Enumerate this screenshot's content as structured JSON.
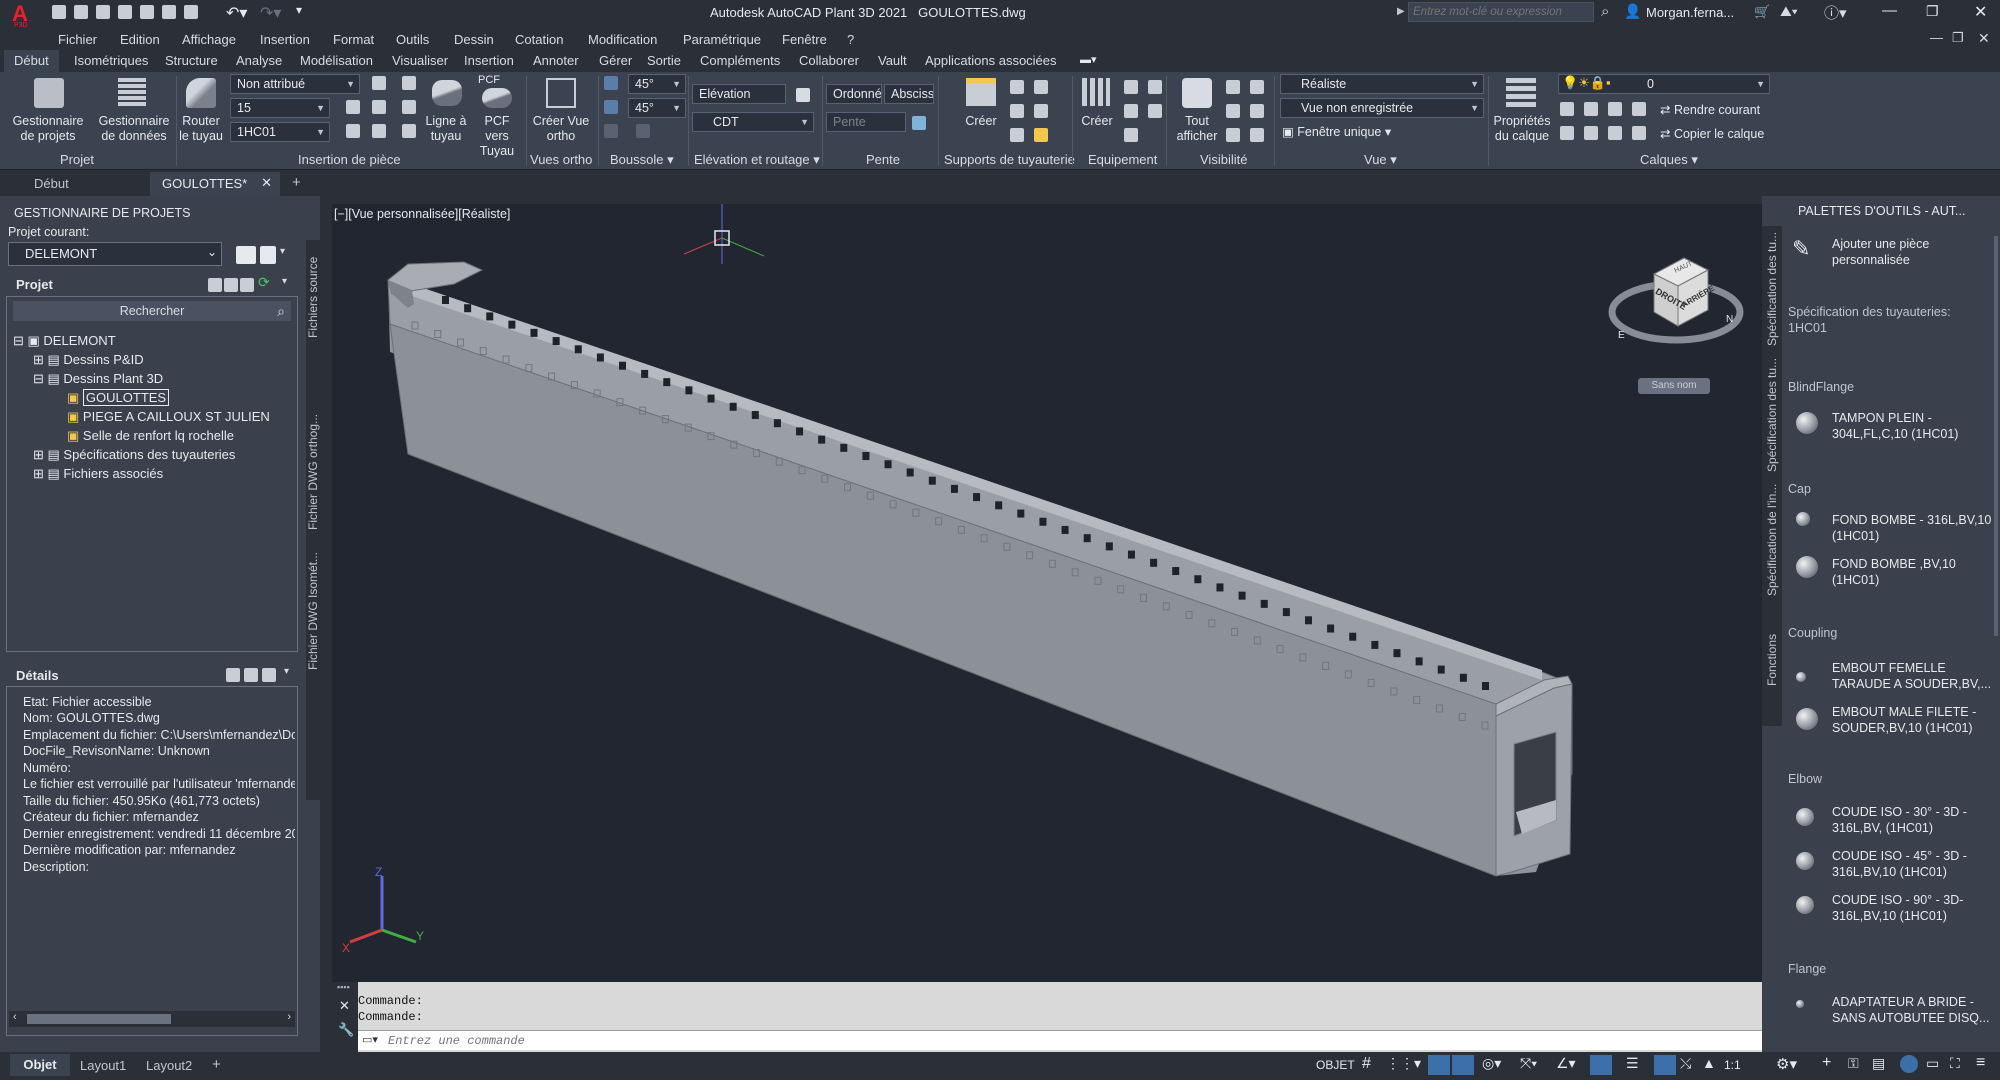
{
  "app": {
    "logo": "A",
    "logo_sub": "P3D",
    "title": "Autodesk AutoCAD Plant 3D 2021",
    "file": "GOULOTTES.dwg",
    "search_placeholder": "Entrez mot-clé ou expression",
    "user": "Morgan.ferna..."
  },
  "menu": [
    "Fichier",
    "Edition",
    "Affichage",
    "Insertion",
    "Format",
    "Outils",
    "Dessin",
    "Cotation",
    "Modification",
    "Paramétrique",
    "Fenêtre",
    "?"
  ],
  "ribbon_tabs": [
    "Début",
    "Isométriques",
    "Structure",
    "Analyse",
    "Modélisation",
    "Visualiser",
    "Insertion",
    "Annoter",
    "Gérer",
    "Sortie",
    "Compléments",
    "Collaborer",
    "Vault",
    "Applications associées"
  ],
  "ribbon": {
    "gestionnaire_projets": "Gestionnaire de projets",
    "gestionnaire_donnees": "Gestionnaire de données",
    "panel_projet": "Projet",
    "router": "Router le tuyau",
    "combo_attribut": "Non attribué",
    "combo_size": "15",
    "combo_spec": "1HC01",
    "ligne_tuyau": "Ligne à tuyau",
    "pcf": "PCF",
    "pcf_tuyau": "PCF vers Tuyau",
    "panel_insertion": "Insertion de pièce",
    "creer_vue": "Créer Vue ortho",
    "panel_vues": "Vues ortho",
    "angle1": "45°",
    "angle2": "45°",
    "panel_boussole": "Boussole",
    "elevation": "Elévation",
    "cdt": "CDT",
    "panel_elev": "Elévation et routage",
    "ordonnee": "Ordonné",
    "abscisse": "Abscisse",
    "pente": "Pente",
    "panel_pente": "Pente",
    "creer_supports": "Créer",
    "panel_supports": "Supports de tuyauterie",
    "creer_equip": "Créer",
    "panel_equip": "Equipement",
    "tout_afficher": "Tout afficher",
    "panel_visibilite": "Visibilité",
    "style_visuel": "Réaliste",
    "vue_nom": "Vue non enregistrée",
    "fenetre": "Fenêtre unique",
    "panel_vue": "Vue",
    "proprietes_calque": "Propriétés du calque",
    "calque_combo": "0",
    "rendre_courant": "Rendre courant",
    "copier_calque": "Copier le calque",
    "panel_calques": "Calques"
  },
  "doc_tabs": [
    "Début",
    "GOULOTTES*"
  ],
  "left": {
    "header": "GESTIONNAIRE DE PROJETS",
    "projet_courant_label": "Projet courant:",
    "projet_courant": "DELEMONT",
    "projet_label": "Projet",
    "rechercher": "Rechercher",
    "tree": [
      "DELEMONT",
      "Dessins P&ID",
      "Dessins Plant 3D",
      "GOULOTTES",
      "PIEGE A CAILLOUX ST JULIEN",
      "Selle de renfort lq rochelle",
      "Spécifications des tuyauteries",
      "Fichiers associés"
    ],
    "vtabs": [
      "Fichiers source",
      "Fichier DWG orthog...",
      "Fichier DWG Isomét..."
    ],
    "details_label": "Détails",
    "details": [
      "Etat: Fichier accessible",
      "Nom: GOULOTTES.dwg",
      "Emplacement du fichier: C:\\Users\\mfernandez\\Do",
      "DocFile_RevisonName: Unknown",
      "Numéro:",
      "Le fichier est verrouillé par l'utilisateur 'mfernande",
      "Taille du fichier: 450.95Ko (461,773 octets)",
      "Créateur du fichier: mfernandez",
      "Dernier enregistrement: vendredi 11 décembre 20",
      "Dernière modification par: mfernandez",
      "Description:"
    ]
  },
  "viewport": {
    "label": "[−][Vue personnalisée][Réaliste]",
    "viewcube_top": "HAUT",
    "viewcube_left": "DROITE",
    "viewcube_right": "ARRIÈRE",
    "compass_n": "N",
    "compass_e": "E",
    "sans_nom": "Sans nom"
  },
  "command": {
    "line1": "Commande:",
    "line2": "Commande:",
    "placeholder": "Entrez une commande"
  },
  "right": {
    "header": "PALETTES D'OUTILS - AUT...",
    "vtabs": [
      "Spécification des tu...",
      "Spécification des tu...",
      "Spécification de l'in...",
      "Fonctions"
    ],
    "add_piece": "Ajouter une pièce personnalisée",
    "spec": "Spécification des tuyauteries: 1HC01",
    "sections": [
      {
        "name": "BlindFlange",
        "items": [
          "TAMPON PLEIN - 304L,FL,C,10 (1HC01)"
        ]
      },
      {
        "name": "Cap",
        "items": [
          "FOND BOMBE - 316L,BV,10 (1HC01)",
          "FOND BOMBE ,BV,10 (1HC01)"
        ]
      },
      {
        "name": "Coupling",
        "items": [
          "EMBOUT FEMELLE TARAUDE A SOUDER,BV,...",
          "EMBOUT MALE FILETE - SOUDER,BV,10 (1HC01)"
        ]
      },
      {
        "name": "Elbow",
        "items": [
          "COUDE ISO - 30° - 3D - 316L,BV, (1HC01)",
          "COUDE ISO - 45° - 3D - 316L,BV,10 (1HC01)",
          "COUDE ISO - 90° - 3D- 316L,BV,10 (1HC01)"
        ]
      },
      {
        "name": "Flange",
        "items": [
          "ADAPTATEUR A BRIDE - SANS AUTOBUTEE DISQ..."
        ]
      }
    ]
  },
  "layout_tabs": [
    "Objet",
    "Layout1",
    "Layout2"
  ],
  "status": {
    "objet": "OBJET",
    "scale": "1:1"
  }
}
